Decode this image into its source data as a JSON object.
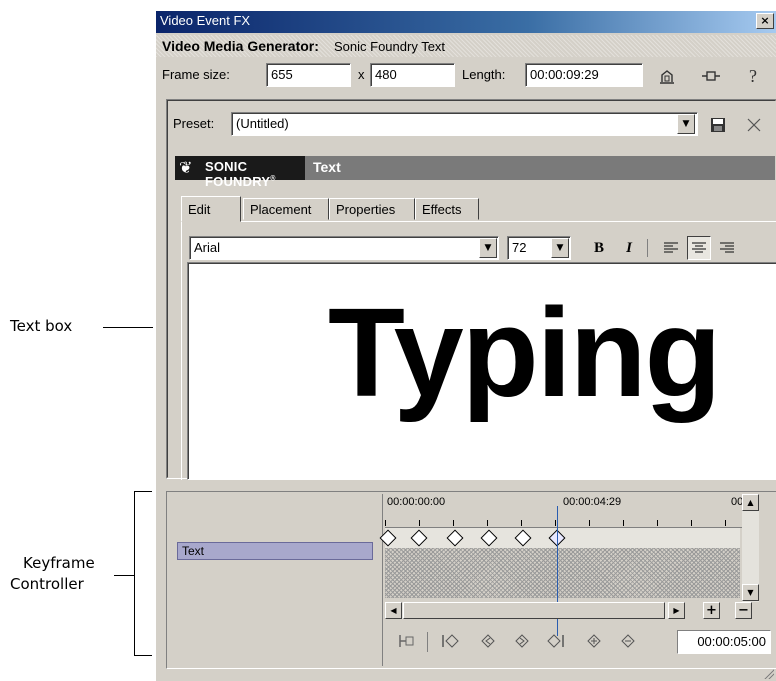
{
  "callouts": {
    "text_box": "Text box",
    "keyframe_line1": "Keyframe",
    "keyframe_line2": "Controller"
  },
  "window": {
    "title": "Video Event FX",
    "close_glyph": "×"
  },
  "generator": {
    "label": "Video Media Generator:",
    "value": "Sonic Foundry Text"
  },
  "frame": {
    "size_label": "Frame size:",
    "width": "655",
    "x_label": "x",
    "height": "480",
    "length_label": "Length:",
    "length": "00:00:09:29"
  },
  "preset": {
    "label": "Preset:",
    "value": "(Untitled)"
  },
  "banner": {
    "brand": "SONIC FOUNDRY",
    "brand_mark": "®",
    "plugin": "Text"
  },
  "tabs": [
    "Edit",
    "Placement",
    "Properties",
    "Effects"
  ],
  "format": {
    "font": "Arial",
    "size": "72",
    "bold": "B",
    "italic": "I"
  },
  "text_content": "Typing",
  "keyframe": {
    "track": "Text",
    "ruler": [
      "00:00:00:00",
      "00:00:04:29",
      "00:"
    ],
    "time": "00:00:05:00",
    "plus": "+",
    "minus": "−"
  },
  "icons": {
    "properties": "properties-icon",
    "plugin_chain": "plugin-chain-icon",
    "help": "help-icon",
    "save": "save-icon",
    "delete": "delete-icon"
  }
}
